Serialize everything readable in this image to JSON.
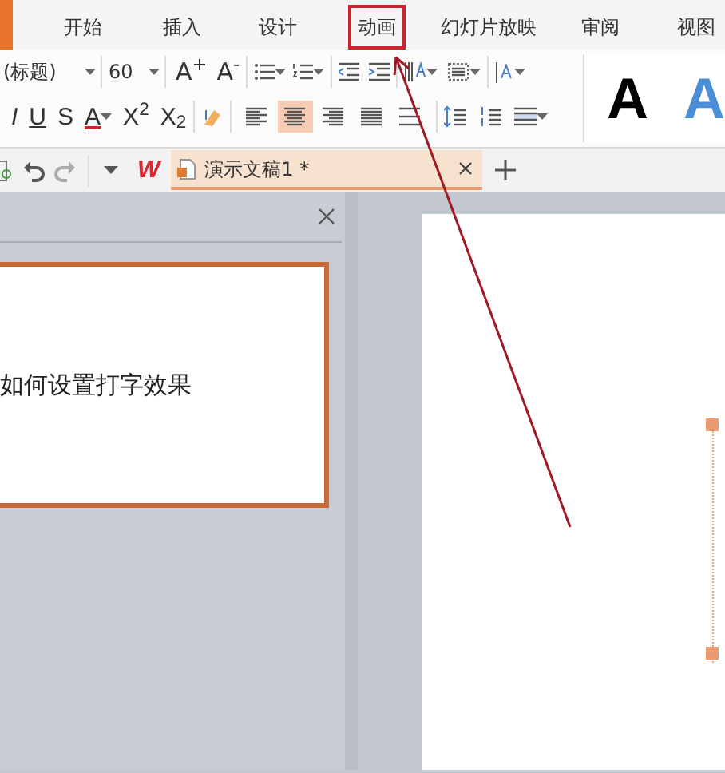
{
  "ribbon_tabs": [
    {
      "label": "开始",
      "annotated": false
    },
    {
      "label": "插入",
      "annotated": false
    },
    {
      "label": "设计",
      "annotated": false
    },
    {
      "label": "动画",
      "annotated": true
    },
    {
      "label": "幻灯片放映",
      "annotated": false
    },
    {
      "label": "审阅",
      "annotated": false
    },
    {
      "label": "视图",
      "annotated": false
    }
  ],
  "font": {
    "name": "(标题)",
    "size": "60",
    "size_buttons": [
      "A$^{+}$",
      "A$^{-}$"
    ]
  },
  "format_buttons": [
    "I",
    "U",
    "S",
    "A",
    "X$^{2}$",
    "X$_{2}$"
  ],
  "alignment": [
    {
      "selected": false
    },
    {
      "selected": true
    },
    {
      "selected": false
    },
    {
      "selected": false
    },
    {
      "selected": false
    }
  ],
  "style_gallery": [
    {
      "label": "A",
      "color": "#000000"
    },
    {
      "label": "A",
      "color": "#4a8fd6"
    }
  ],
  "quick_access": {
    "logo": "W"
  },
  "document_tabs": [
    {
      "title": "演示文稿1 *",
      "selected": true
    }
  ],
  "thumbnail": {
    "text": "如何设置打字效果",
    "selected": true
  }
}
